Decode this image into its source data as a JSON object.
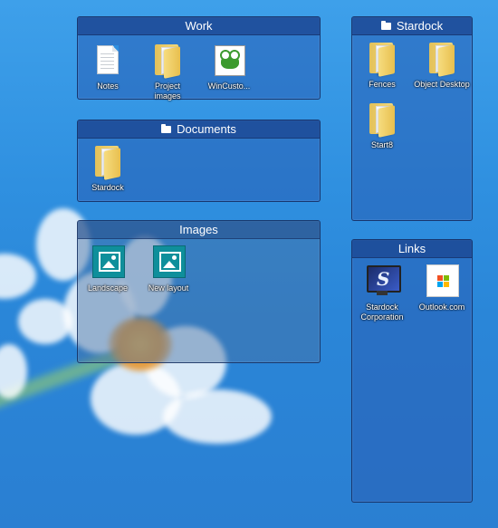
{
  "fences": {
    "work": {
      "title": "Work",
      "items": [
        {
          "label": "Notes",
          "icon": "document-icon"
        },
        {
          "label": "Project images",
          "icon": "folder-icon"
        },
        {
          "label": "WinCusto...",
          "icon": "wincustomize-frog-icon"
        }
      ]
    },
    "documents": {
      "title": "Documents",
      "items": [
        {
          "label": "Stardock",
          "icon": "folder-icon"
        }
      ]
    },
    "images": {
      "title": "Images",
      "items": [
        {
          "label": "Landscape",
          "icon": "image-file-icon"
        },
        {
          "label": "New layout",
          "icon": "image-file-icon"
        }
      ]
    },
    "stardock": {
      "title": "Stardock",
      "items": [
        {
          "label": "Fences",
          "icon": "folder-icon"
        },
        {
          "label": "Object Desktop",
          "icon": "folder-icon"
        },
        {
          "label": "Start8",
          "icon": "folder-icon"
        }
      ]
    },
    "links": {
      "title": "Links",
      "items": [
        {
          "label": "Stardock Corporation",
          "icon": "stardock-monitor-icon"
        },
        {
          "label": "Outlook.com",
          "icon": "windows-logo-icon"
        }
      ]
    }
  },
  "colors": {
    "desktop_blue": "#2f90e0",
    "fence_fill": "rgba(40,95,180,0.55)",
    "fence_border": "#142d5f"
  }
}
